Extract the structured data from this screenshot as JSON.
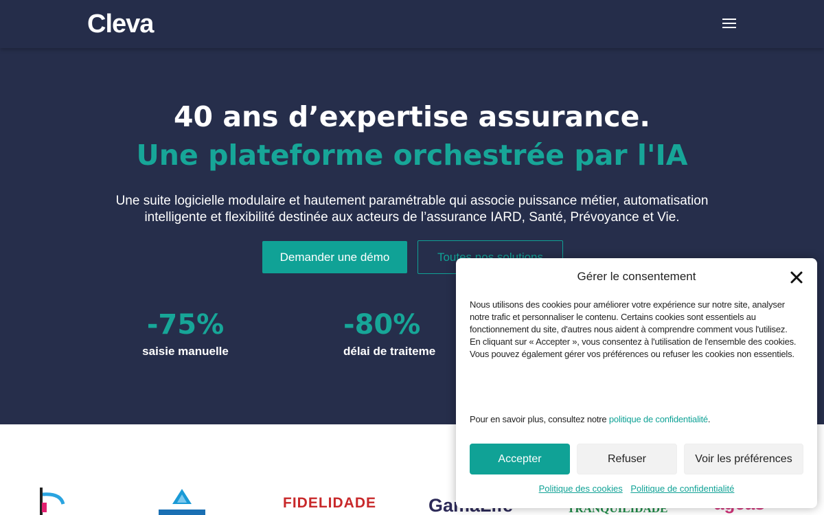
{
  "header": {
    "logo": "Cleva",
    "menu_icon": "hamburger-menu-icon"
  },
  "hero": {
    "title_line1": "40 ans d’expertise assurance.",
    "title_line2": "Une plateforme orchestrée par l'IA",
    "lead": "Une suite logicielle modulaire et hautement paramétrable qui associe puissance métier, automatisation intelligente et flexibilité destinée aux acteurs de l’assurance IARD, Santé, Prévoyance et Vie.",
    "btn_demo": "Demander une démo",
    "btn_solutions": "Toutes nos solutions",
    "stats": [
      {
        "value": "-75%",
        "label": "saisie manuelle"
      },
      {
        "value": "-80%",
        "label": "délai de traiteme"
      }
    ]
  },
  "logos": {
    "fidelidade": "FIDELIDADE",
    "gamalife": "GamaLife",
    "tranquilidade": "TRANQUILIDADE",
    "ageas": "ageas"
  },
  "consent": {
    "title": "Gérer le consentement",
    "body": "Nous utilisons des cookies pour améliorer votre expérience sur notre site, analyser notre trafic et personnaliser le contenu. Certains cookies sont essentiels au fonctionnement du site, d'autres nous aident à comprendre comment vous l'utilisez.",
    "body2": "En cliquant sur « Accepter », vous consentez à l'utilisation de l'ensemble des cookies. Vous pouvez également gérer vos préférences ou refuser les cookies non essentiels.",
    "more_prefix": "Pour en savoir plus, consultez notre ",
    "more_link": "politique de confidentialité",
    "more_suffix": ".",
    "btn_accept": "Accepter",
    "btn_refuse": "Refuser",
    "btn_prefs": "Voir les préférences",
    "link_cookies": "Politique des cookies",
    "link_privacy": "Politique de confidentialité"
  },
  "colors": {
    "navy": "#262e4b",
    "teal": "#10a296",
    "white": "#ffffff"
  }
}
